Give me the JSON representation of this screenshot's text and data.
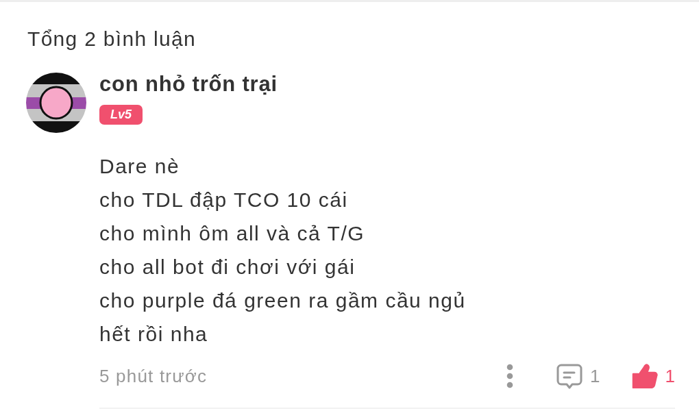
{
  "header": {
    "title": "Tổng 2 bình luận"
  },
  "comments": [
    {
      "author": {
        "name": "con nhỏ trốn trại",
        "level_badge": "Lv5"
      },
      "lines": [
        "Dare nè",
        "cho TDL đập TCO 10 cái",
        "cho mình ôm all và cả T/G",
        "cho all bot đi chơi với gái",
        "cho purple đá green ra gầm cầu ngủ",
        "hết rồi nha"
      ],
      "time": "5 phút trước",
      "reply_count": "1",
      "like_count": "1",
      "liked": true
    }
  ]
}
